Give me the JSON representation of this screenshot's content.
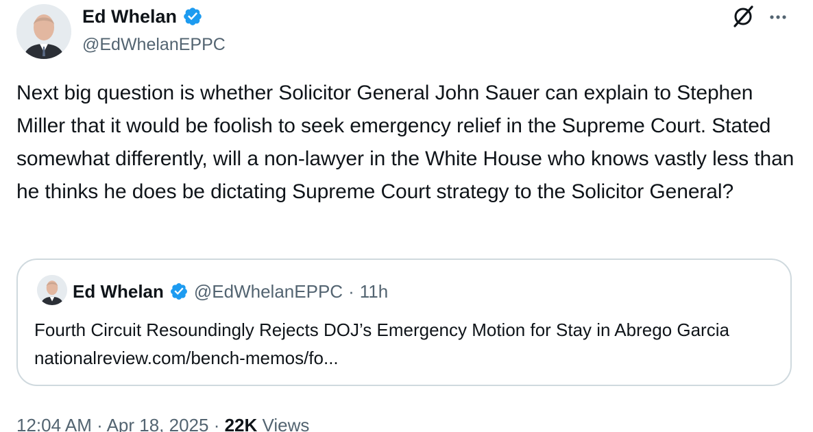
{
  "author": {
    "display_name": "Ed Whelan",
    "handle": "@EdWhelanEPPC",
    "verified": true,
    "avatar_icon": "avatar-photo"
  },
  "actions": {
    "grok_icon": "grok-icon",
    "more_icon": "more-icon"
  },
  "tweet": {
    "text": "Next big question is whether Solicitor General John Sauer can explain to Stephen Miller that it would be foolish to seek emergency relief in the Supreme Court. Stated somewhat differently, will a non-lawyer in the White House who knows vastly less than he thinks he does be dictating Supreme Court strategy to the Solicitor General?"
  },
  "quoted_tweet": {
    "display_name": "Ed Whelan",
    "handle": "@EdWhelanEPPC",
    "separator": "·",
    "time": "11h",
    "text": "Fourth Circuit Resoundingly Rejects DOJ’s Emergency Motion for Stay in Abrego Garcia nationalreview.com/bench-memos/fo..."
  },
  "meta": {
    "time": "12:04 AM",
    "separator": "·",
    "date": "Apr 18, 2025",
    "views_count": "22K",
    "views_label": "Views"
  },
  "colors": {
    "verified_blue": "#1d9bf0",
    "secondary_text": "#536471",
    "primary_text": "#0f1419",
    "border": "#cfd9de"
  }
}
